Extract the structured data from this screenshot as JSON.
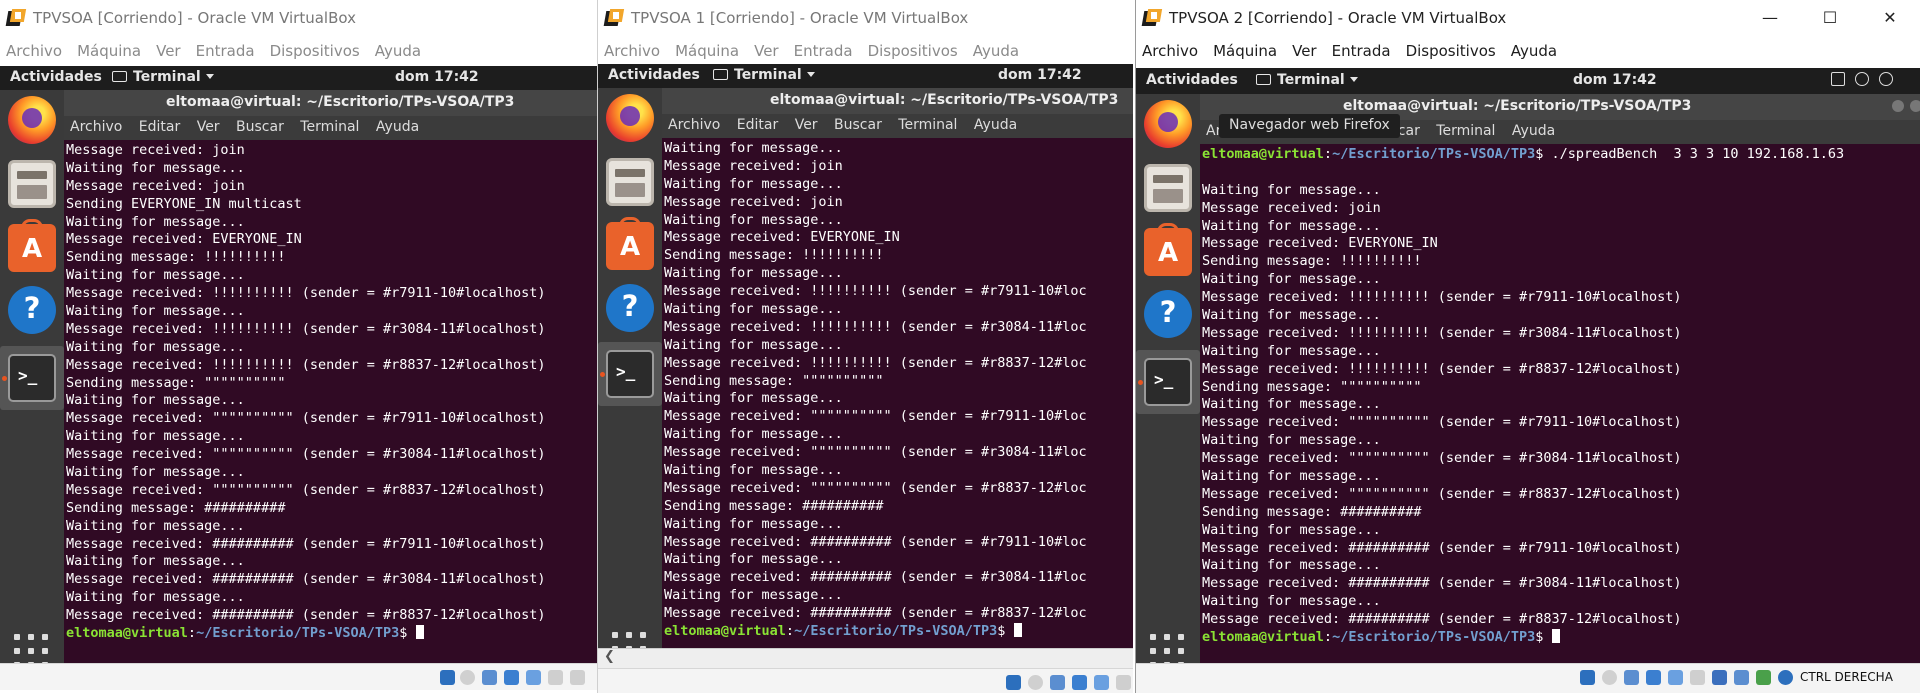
{
  "virtualbox": {
    "menu": [
      "Archivo",
      "Máquina",
      "Ver",
      "Entrada",
      "Dispositivos",
      "Ayuda"
    ],
    "window_controls": [
      "—",
      "☐",
      "✕"
    ],
    "status_label": "CTRL DERECHA"
  },
  "guest": {
    "activities": "Actividades",
    "app_menu": "Terminal",
    "clock": "dom 17:42",
    "terminal_title": "eltomaa@virtual: ~/Escritorio/TPs-VSOA/TP3",
    "terminal_menu": [
      "Archivo",
      "Editar",
      "Ver",
      "Buscar",
      "Terminal",
      "Ayuda"
    ],
    "dock_tooltip": "Navegador web Firefox",
    "prompt": {
      "user": "eltomaa@virtual",
      "sep": ":",
      "path": "~/Escritorio/TPs-VSOA/TP3",
      "end": "$ "
    }
  },
  "vms": [
    {
      "title": "TPVSOA [Corriendo] - Oracle VM VirtualBox",
      "lines": [
        "Message received: join",
        "Waiting for message...",
        "Message received: join",
        "Sending EVERYONE_IN multicast",
        "Waiting for message...",
        "Message received: EVERYONE_IN",
        "Sending message: !!!!!!!!!!",
        "Waiting for message...",
        "Message received: !!!!!!!!!! (sender = #r7911-10#localhost)",
        "Waiting for message...",
        "Message received: !!!!!!!!!! (sender = #r3084-11#localhost)",
        "Waiting for message...",
        "Message received: !!!!!!!!!! (sender = #r8837-12#localhost)",
        "Sending message: \"\"\"\"\"\"\"\"\"\"",
        "Waiting for message...",
        "Message received: \"\"\"\"\"\"\"\"\"\" (sender = #r7911-10#localhost)",
        "Waiting for message...",
        "Message received: \"\"\"\"\"\"\"\"\"\" (sender = #r3084-11#localhost)",
        "Waiting for message...",
        "Message received: \"\"\"\"\"\"\"\"\"\" (sender = #r8837-12#localhost)",
        "Sending message: ##########",
        "Waiting for message...",
        "Message received: ########## (sender = #r7911-10#localhost)",
        "Waiting for message...",
        "Message received: ########## (sender = #r3084-11#localhost)",
        "Waiting for message...",
        "Message received: ########## (sender = #r8837-12#localhost)"
      ]
    },
    {
      "title": "TPVSOA 1 [Corriendo] - Oracle VM VirtualBox",
      "lines": [
        "Waiting for message...",
        "Message received: join",
        "Waiting for message...",
        "Message received: join",
        "Waiting for message...",
        "Message received: EVERYONE_IN",
        "Sending message: !!!!!!!!!!",
        "Waiting for message...",
        "Message received: !!!!!!!!!! (sender = #r7911-10#loc",
        "Waiting for message...",
        "Message received: !!!!!!!!!! (sender = #r3084-11#loc",
        "Waiting for message...",
        "Message received: !!!!!!!!!! (sender = #r8837-12#loc",
        "Sending message: \"\"\"\"\"\"\"\"\"\"",
        "Waiting for message...",
        "Message received: \"\"\"\"\"\"\"\"\"\" (sender = #r7911-10#loc",
        "Waiting for message...",
        "Message received: \"\"\"\"\"\"\"\"\"\" (sender = #r3084-11#loc",
        "Waiting for message...",
        "Message received: \"\"\"\"\"\"\"\"\"\" (sender = #r8837-12#loc",
        "Sending message: ##########",
        "Waiting for message...",
        "Message received: ########## (sender = #r7911-10#loc",
        "Waiting for message...",
        "Message received: ########## (sender = #r3084-11#loc",
        "Waiting for message...",
        "Message received: ########## (sender = #r8837-12#loc"
      ]
    },
    {
      "title": "TPVSOA 2 [Corriendo] - Oracle VM VirtualBox",
      "command": "./spreadBench  3 3 3 10 192.168.1.63",
      "lines": [
        "",
        "Waiting for message...",
        "Message received: join",
        "Waiting for message...",
        "Message received: EVERYONE_IN",
        "Sending message: !!!!!!!!!!",
        "Waiting for message...",
        "Message received: !!!!!!!!!! (sender = #r7911-10#localhost)",
        "Waiting for message...",
        "Message received: !!!!!!!!!! (sender = #r3084-11#localhost)",
        "Waiting for message...",
        "Message received: !!!!!!!!!! (sender = #r8837-12#localhost)",
        "Sending message: \"\"\"\"\"\"\"\"\"\"",
        "Waiting for message...",
        "Message received: \"\"\"\"\"\"\"\"\"\" (sender = #r7911-10#localhost)",
        "Waiting for message...",
        "Message received: \"\"\"\"\"\"\"\"\"\" (sender = #r3084-11#localhost)",
        "Waiting for message...",
        "Message received: \"\"\"\"\"\"\"\"\"\" (sender = #r8837-12#localhost)",
        "Sending message: ##########",
        "Waiting for message...",
        "Message received: ########## (sender = #r7911-10#localhost)",
        "Waiting for message...",
        "Message received: ########## (sender = #r3084-11#localhost)",
        "Waiting for message...",
        "Message received: ########## (sender = #r8837-12#localhost)"
      ]
    }
  ],
  "colors": {
    "terminal_bg": "#300a24",
    "prompt_user": "#8ae234",
    "prompt_path": "#729fcf",
    "accent": "#e95420"
  }
}
